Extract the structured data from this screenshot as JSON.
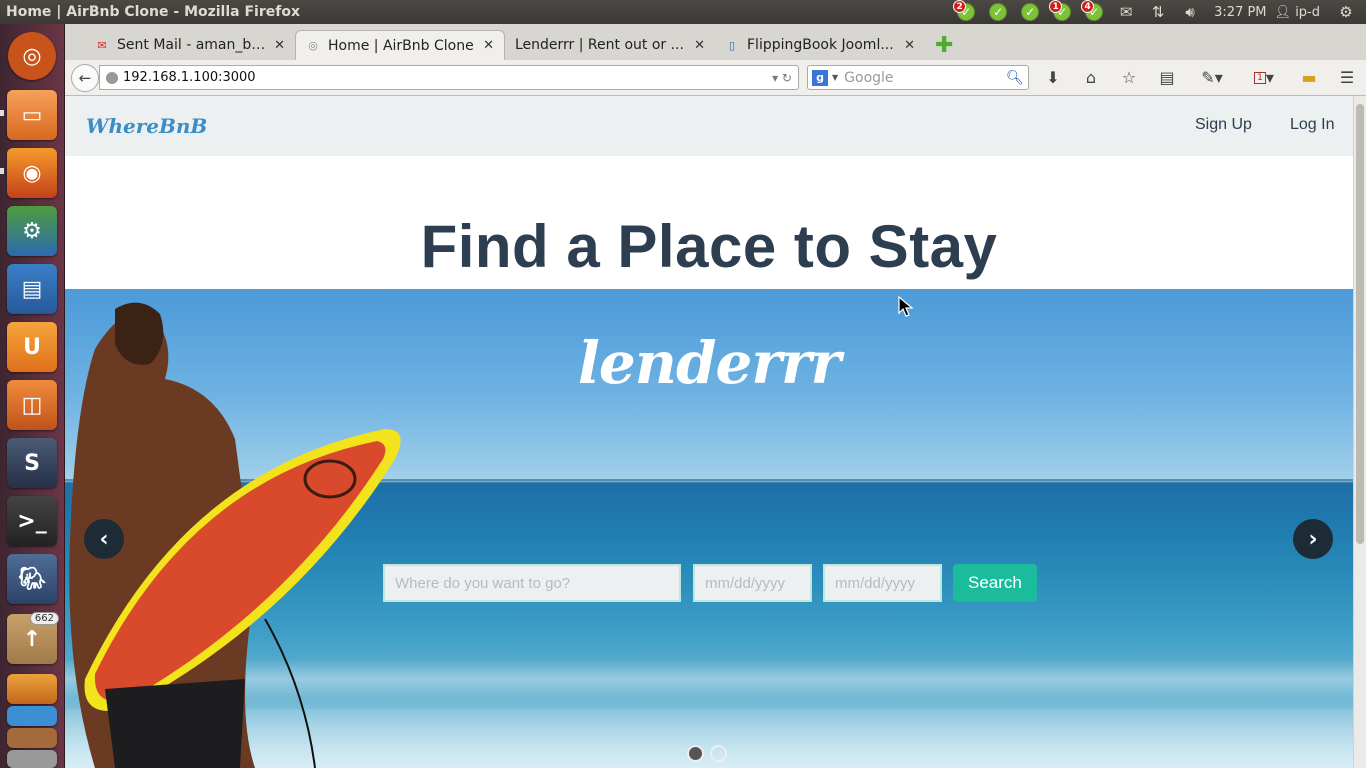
{
  "top_panel": {
    "window_title": "Home | AirBnb Clone - Mozilla Firefox",
    "badges": [
      "2",
      "1",
      "4"
    ],
    "clock": "3:27 PM",
    "user": "ip-d"
  },
  "launcher": {
    "badge_count": "662"
  },
  "browser": {
    "tabs": [
      {
        "label": "Sent Mail - aman_ba...",
        "icon": "gmail-icon"
      },
      {
        "label": "Home | AirBnb Clone",
        "icon": "page-icon"
      },
      {
        "label": "Lenderrr | Rent out or ...",
        "icon": "none"
      },
      {
        "label": "FlippingBook Jooml...",
        "icon": "flippingbook-icon"
      }
    ],
    "active_tab": 1,
    "url": "192.168.1.100:3000",
    "search_placeholder": "Google",
    "notification_count": "1"
  },
  "site": {
    "brand": "WhereBnB",
    "nav": {
      "sign_up": "Sign Up",
      "log_in": "Log In"
    },
    "hero_title": "Find a Place to Stay",
    "carousel_logo": "lenderrr",
    "search": {
      "location_placeholder": "Where do you want to go?",
      "checkin_placeholder": "mm/dd/yyyy",
      "checkout_placeholder": "mm/dd/yyyy",
      "button_label": "Search"
    },
    "slides": 2,
    "active_slide": 0
  },
  "colors": {
    "brand": "#3c8dc5",
    "heading": "#2c3e50",
    "accent": "#1abc9c",
    "nav_bg": "#ecf0f1"
  }
}
